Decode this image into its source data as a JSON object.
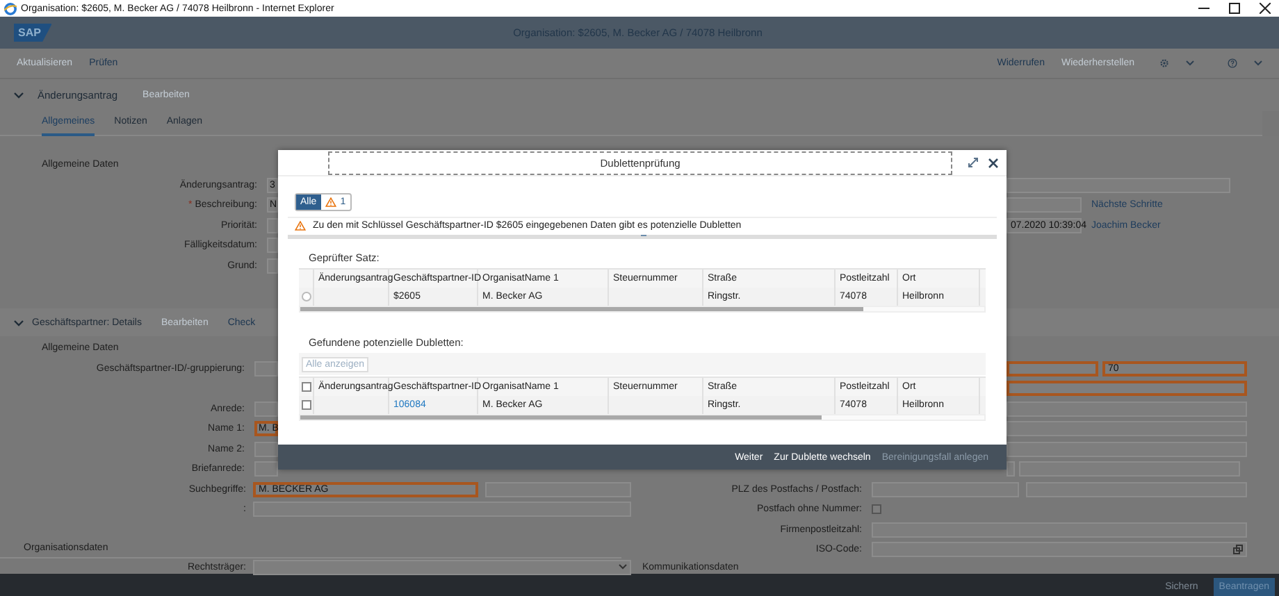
{
  "window": {
    "title": "Organisation: $2605, M. Becker AG / 74078 Heilbronn - Internet Explorer"
  },
  "shell": {
    "logo": "SAP",
    "title": "Organisation: $2605, M. Becker AG / 74078 Heilbronn"
  },
  "toolbar": {
    "left": [
      {
        "label": "Aktualisieren",
        "disabled": true
      },
      {
        "label": "Prüfen",
        "disabled": false
      }
    ],
    "right": [
      {
        "label": "Widerrufen",
        "disabled": false
      },
      {
        "label": "Wiederherstellen",
        "disabled": true
      }
    ]
  },
  "change_request": {
    "title": "Änderungsantrag",
    "expanded": true,
    "actions": [
      {
        "label": "Bearbeiten",
        "disabled": true
      }
    ],
    "tabs": [
      {
        "label": "Allgemeines",
        "selected": true
      },
      {
        "label": "Notizen",
        "selected": false
      },
      {
        "label": "Anlagen",
        "selected": false
      }
    ],
    "panel_title": "Allgemeine Daten",
    "fields": [
      {
        "kind": "field",
        "label": "Änderungsantrag:",
        "value": "3"
      },
      {
        "kind": "field",
        "label": "Beschreibung:",
        "required_mark": "*",
        "value": "N"
      },
      {
        "kind": "field",
        "label": "Priorität:"
      },
      {
        "kind": "field",
        "label": "Fälligkeitsdatum:"
      },
      {
        "kind": "field",
        "label": "Grund:"
      }
    ],
    "side_rows": [
      {
        "kind": "wide"
      },
      {
        "kind": "short",
        "link": "Nächste Schritte"
      },
      {
        "kind": "short",
        "value": "07.2020 10:39:04",
        "link": "Joachim Becker"
      }
    ]
  },
  "partner": {
    "title": "Geschäftspartner: Details",
    "expanded": true,
    "actions": [
      {
        "label": "Bearbeiten",
        "disabled": true
      },
      {
        "label": "Check",
        "disabled": false
      }
    ],
    "panel_title": "Allgemeine Daten",
    "fields": [
      {
        "kind": "field",
        "label": "Geschäftspartner-ID/-gruppierung:",
        "highlight": false
      },
      {
        "kind": "blank"
      },
      {
        "kind": "field",
        "label": "Anrede:",
        "highlight": false
      },
      {
        "kind": "field",
        "label": "Name 1:",
        "value": "M. B",
        "highlight": true
      },
      {
        "kind": "field",
        "label": "Name 2:",
        "highlight": false
      },
      {
        "kind": "field",
        "label": "Briefanrede:",
        "highlight": false
      }
    ],
    "side_rows": [
      {
        "kind": "pair",
        "value": "70",
        "highlight": true
      },
      {
        "kind": "wide",
        "highlight": true
      },
      {
        "kind": "wide"
      },
      {
        "kind": "wide"
      },
      {
        "kind": "wide"
      },
      {
        "kind": "icon_pair"
      }
    ],
    "left_rows": [
      {
        "kind": "fields",
        "label": "Suchbegriffe:",
        "fields": [
          {
            "value": "M. BECKER AG",
            "highlight": true
          },
          {
            "highlight": false
          }
        ]
      },
      {
        "kind": "fields",
        "label": ":",
        "fields": [
          {
            "highlight": false
          }
        ]
      },
      {
        "kind": "blank"
      },
      {
        "kind": "heading",
        "label": "Organisationsdaten"
      },
      {
        "kind": "select",
        "label": "Rechtsträger:"
      }
    ],
    "right_rows": [
      {
        "kind": "fields",
        "label": "PLZ des Postfachs / Postfach:",
        "fields": [
          {
            "highlight": false
          },
          {
            "highlight": false
          }
        ]
      },
      {
        "kind": "checkbox",
        "label": "Postfach ohne Nummer:",
        "checked": false
      },
      {
        "kind": "fields",
        "label": "Firmenpostleitzahl:",
        "fields": [
          {
            "highlight": false
          }
        ]
      },
      {
        "kind": "icon_field",
        "label": "ISO-Code:"
      },
      {
        "kind": "heading",
        "label": "Kommunikationsdaten"
      }
    ]
  },
  "footer": {
    "buttons": [
      {
        "label": "Sichern",
        "emphasized": false
      },
      {
        "label": "Beantragen",
        "emphasized": true
      }
    ]
  },
  "dialog": {
    "title": "Dublettenprüfung",
    "filters": [
      {
        "kind": "text",
        "label": "Alle",
        "selected": true
      },
      {
        "kind": "warning",
        "label": "1",
        "selected": false
      }
    ],
    "message": "Zu den mit Schlüssel Geschäftspartner-ID $2605 eingegebenen Daten gibt es potenzielle Dubletten",
    "checked_title": "Geprüfter Satz:",
    "checked_columns": [
      "Änderungsantrag",
      "Geschäftspartner-ID",
      "OrganisatName 1",
      "Steuernummer",
      "Straße",
      "Postleitzahl",
      "Ort"
    ],
    "checked_rows": [
      {
        "selected": false,
        "partner_id": "$2605",
        "name": "M. Becker AG",
        "street": "Ringstr.",
        "postcode": "74078",
        "city": "Heilbronn"
      }
    ],
    "found_title": "Gefundene potenzielle Dubletten:",
    "show_all": {
      "label": "Alle anzeigen",
      "disabled": true
    },
    "found_all_checked": false,
    "found_columns": [
      "Änderungsantrag",
      "Geschäftspartner-ID",
      "OrganisatName 1",
      "Steuernummer",
      "Straße",
      "Postleitzahl",
      "Ort"
    ],
    "found_rows": [
      {
        "checked": false,
        "partner_id": "106084",
        "name": "M. Becker AG",
        "street": "Ringstr.",
        "postcode": "74078",
        "city": "Heilbronn"
      }
    ],
    "buttons": [
      {
        "label": "Weiter",
        "disabled": false
      },
      {
        "label": "Zur Dublette wechseln",
        "disabled": false
      },
      {
        "label": "Bereinigungsfall anlegen",
        "disabled": true
      }
    ]
  }
}
